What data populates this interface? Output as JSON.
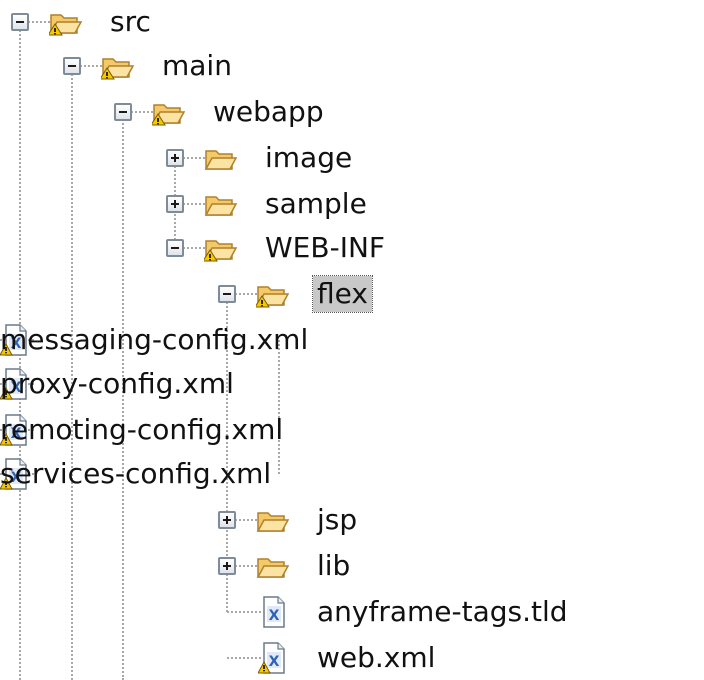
{
  "tree": {
    "nodes": [
      {
        "label": "src",
        "icon": "folder-warning-icon",
        "state": "expanded"
      },
      {
        "label": "main",
        "icon": "folder-warning-icon",
        "state": "expanded"
      },
      {
        "label": "webapp",
        "icon": "folder-warning-icon",
        "state": "expanded"
      },
      {
        "label": "image",
        "icon": "folder-icon",
        "state": "collapsed"
      },
      {
        "label": "sample",
        "icon": "folder-icon",
        "state": "collapsed"
      },
      {
        "label": "WEB-INF",
        "icon": "folder-warning-icon",
        "state": "expanded"
      },
      {
        "label": "flex",
        "icon": "folder-warning-icon",
        "state": "expanded",
        "selected": true
      },
      {
        "label": "messaging-config.xml",
        "icon": "xml-file-warning-icon",
        "state": "leaf"
      },
      {
        "label": "proxy-config.xml",
        "icon": "xml-file-warning-icon",
        "state": "leaf"
      },
      {
        "label": "remoting-config.xml",
        "icon": "xml-file-warning-icon",
        "state": "leaf"
      },
      {
        "label": "services-config.xml",
        "icon": "xml-file-warning-icon",
        "state": "leaf"
      },
      {
        "label": "jsp",
        "icon": "folder-icon",
        "state": "collapsed"
      },
      {
        "label": "lib",
        "icon": "folder-icon",
        "state": "collapsed"
      },
      {
        "label": "anyframe-tags.tld",
        "icon": "xml-file-icon",
        "state": "leaf"
      },
      {
        "label": "web.xml",
        "icon": "xml-file-warning-icon",
        "state": "leaf"
      }
    ]
  },
  "colors": {
    "folder_fill": "#f3c96a",
    "folder_stroke": "#b0802a",
    "warning_fill": "#f6c800",
    "xml_blue": "#2e62b8",
    "selection_bg": "#c8c8c8",
    "tree_line": "#a8a8a8"
  }
}
